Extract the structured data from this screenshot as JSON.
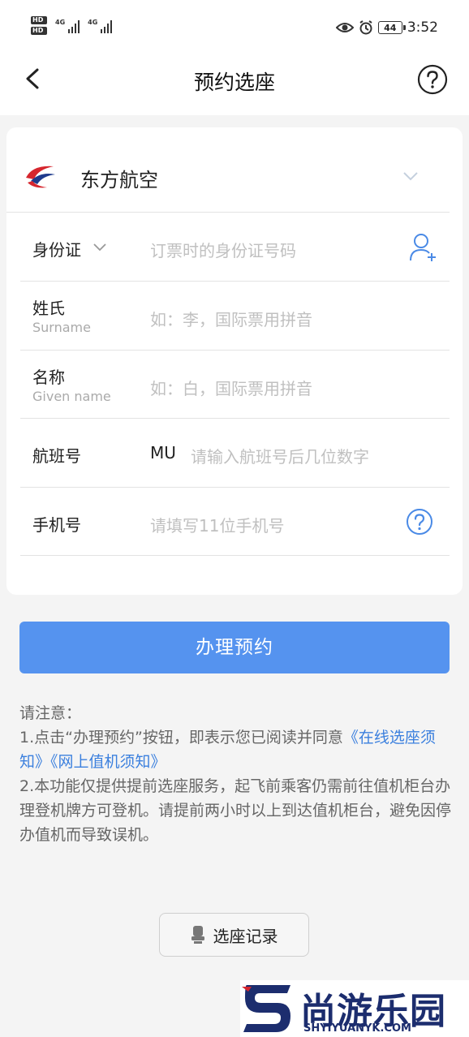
{
  "status_bar": {
    "hd1": "HD",
    "hd2": "HD",
    "net1": "4G",
    "net2": "4G",
    "battery": "44",
    "time": "3:52",
    "icons": [
      "eye-icon",
      "alarm-icon"
    ]
  },
  "nav": {
    "title": "预约选座",
    "back_icon": "chevron-left-icon",
    "help_icon": "question-circle-icon"
  },
  "form": {
    "airline": {
      "name": "东方航空",
      "logo": "china-eastern-logo"
    },
    "id_type": {
      "label": "身份证",
      "placeholder": "订票时的身份证号码"
    },
    "surname": {
      "label": "姓氏",
      "sublabel": "Surname",
      "placeholder": "如：李，国际票用拼音"
    },
    "given_name": {
      "label": "名称",
      "sublabel": "Given name",
      "placeholder": "如：白，国际票用拼音"
    },
    "flight": {
      "label": "航班号",
      "prefix": "MU",
      "placeholder": "请输入航班号后几位数字"
    },
    "phone": {
      "label": "手机号",
      "placeholder": "请填写11位手机号"
    }
  },
  "submit_label": "办理预约",
  "notice": {
    "title": "请注意：",
    "line1_prefix": "1.点击“办理预约”按钮，即表示您已阅读并同意",
    "link1": "《在线选座须知》",
    "link2": "《网上值机须知》",
    "line2": "2.本功能仅提供提前选座服务，起飞前乘客仍需前往值机柜台办理登机牌方可登机。请提前两小时以上到达值机柜台，避免因停办值机而导致误机。"
  },
  "record_button": "选座记录",
  "watermark": {
    "text": "尚游乐园",
    "url": "SHYIYUANYK.COM"
  },
  "colors": {
    "accent": "#5593ef",
    "link": "#3c80de",
    "airline_red": "#d6262e",
    "airline_blue": "#1f3b8d"
  }
}
